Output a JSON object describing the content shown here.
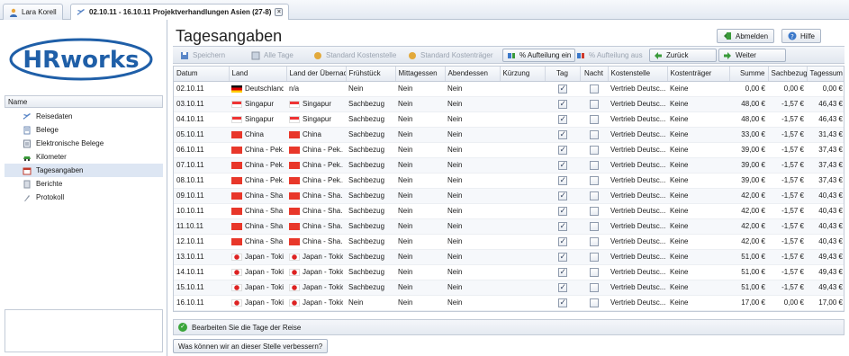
{
  "tabs": [
    {
      "label": "Lara Korell",
      "icon": "user-icon"
    },
    {
      "label": "02.10.11 - 16.10.11 Projektverhandlungen Asien (27-8)",
      "icon": "travel-icon",
      "active": true
    }
  ],
  "logo": {
    "text": "HRworks"
  },
  "sidebar": {
    "header": "Name",
    "items": [
      {
        "label": "Reisedaten",
        "icon": "plane-icon"
      },
      {
        "label": "Belege",
        "icon": "receipt-icon"
      },
      {
        "label": "Elektronische Belege",
        "icon": "document-icon"
      },
      {
        "label": "Kilometer",
        "icon": "car-icon"
      },
      {
        "label": "Tagesangaben",
        "icon": "calendar-icon",
        "selected": true
      },
      {
        "label": "Berichte",
        "icon": "report-icon"
      },
      {
        "label": "Protokoll",
        "icon": "log-icon"
      }
    ]
  },
  "page": {
    "title": "Tagesangaben"
  },
  "header_buttons": {
    "logout": "Abmelden",
    "help": "Hilfe"
  },
  "toolbar": {
    "save": "Speichern",
    "all_days": "Alle Tage",
    "std_cost_center": "Standard Kostenstelle",
    "std_cost_unit": "Standard Kostenträger",
    "split_on": "% Aufteilung ein",
    "split_off": "% Aufteilung aus",
    "back": "Zurück",
    "next": "Weiter"
  },
  "columns": [
    "Datum",
    "Land",
    "Land der Übernac",
    "Frühstück",
    "Mittagessen",
    "Abendessen",
    "Kürzung",
    "Tag",
    "Nacht",
    "Kostenstelle",
    "Kostenträger",
    "Summe",
    "Sachbezug",
    "Tagessum"
  ],
  "rows": [
    {
      "date": "02.10.11",
      "land": "Deutschland",
      "land_flag": "de",
      "over": "n/a",
      "over_flag": "",
      "fruh": "Nein",
      "mittag": "Nein",
      "abend": "Nein",
      "kurz": "",
      "tag": true,
      "nacht": false,
      "kst": "Vertrieb Deutsc...",
      "ktr": "Keine",
      "summe": "0,00 €",
      "sach": "0,00 €",
      "tsum": "0,00 €"
    },
    {
      "date": "03.10.11",
      "land": "Singapur",
      "land_flag": "sg",
      "over": "Singapur",
      "over_flag": "sg",
      "fruh": "Sachbezug",
      "mittag": "Nein",
      "abend": "Nein",
      "kurz": "",
      "tag": true,
      "nacht": false,
      "kst": "Vertrieb Deutsc...",
      "ktr": "Keine",
      "summe": "48,00 €",
      "sach": "-1,57 €",
      "tsum": "46,43 €"
    },
    {
      "date": "04.10.11",
      "land": "Singapur",
      "land_flag": "sg",
      "over": "Singapur",
      "over_flag": "sg",
      "fruh": "Sachbezug",
      "mittag": "Nein",
      "abend": "Nein",
      "kurz": "",
      "tag": true,
      "nacht": false,
      "kst": "Vertrieb Deutsc...",
      "ktr": "Keine",
      "summe": "48,00 €",
      "sach": "-1,57 €",
      "tsum": "46,43 €"
    },
    {
      "date": "05.10.11",
      "land": "China",
      "land_flag": "cn",
      "over": "China",
      "over_flag": "cn",
      "fruh": "Sachbezug",
      "mittag": "Nein",
      "abend": "Nein",
      "kurz": "",
      "tag": true,
      "nacht": false,
      "kst": "Vertrieb Deutsc...",
      "ktr": "Keine",
      "summe": "33,00 €",
      "sach": "-1,57 €",
      "tsum": "31,43 €"
    },
    {
      "date": "06.10.11",
      "land": "China - Pek...",
      "land_flag": "cn",
      "over": "China - Pek...",
      "over_flag": "cn",
      "fruh": "Sachbezug",
      "mittag": "Nein",
      "abend": "Nein",
      "kurz": "",
      "tag": true,
      "nacht": false,
      "kst": "Vertrieb Deutsc...",
      "ktr": "Keine",
      "summe": "39,00 €",
      "sach": "-1,57 €",
      "tsum": "37,43 €"
    },
    {
      "date": "07.10.11",
      "land": "China - Pek...",
      "land_flag": "cn",
      "over": "China - Pek...",
      "over_flag": "cn",
      "fruh": "Sachbezug",
      "mittag": "Nein",
      "abend": "Nein",
      "kurz": "",
      "tag": true,
      "nacht": false,
      "kst": "Vertrieb Deutsc...",
      "ktr": "Keine",
      "summe": "39,00 €",
      "sach": "-1,57 €",
      "tsum": "37,43 €"
    },
    {
      "date": "08.10.11",
      "land": "China - Pek...",
      "land_flag": "cn",
      "over": "China - Pek...",
      "over_flag": "cn",
      "fruh": "Sachbezug",
      "mittag": "Nein",
      "abend": "Nein",
      "kurz": "",
      "tag": true,
      "nacht": false,
      "kst": "Vertrieb Deutsc...",
      "ktr": "Keine",
      "summe": "39,00 €",
      "sach": "-1,57 €",
      "tsum": "37,43 €"
    },
    {
      "date": "09.10.11",
      "land": "China - Sha...",
      "land_flag": "cn",
      "over": "China - Sha...",
      "over_flag": "cn",
      "fruh": "Sachbezug",
      "mittag": "Nein",
      "abend": "Nein",
      "kurz": "",
      "tag": true,
      "nacht": false,
      "kst": "Vertrieb Deutsc...",
      "ktr": "Keine",
      "summe": "42,00 €",
      "sach": "-1,57 €",
      "tsum": "40,43 €"
    },
    {
      "date": "10.10.11",
      "land": "China - Sha...",
      "land_flag": "cn",
      "over": "China - Sha...",
      "over_flag": "cn",
      "fruh": "Sachbezug",
      "mittag": "Nein",
      "abend": "Nein",
      "kurz": "",
      "tag": true,
      "nacht": false,
      "kst": "Vertrieb Deutsc...",
      "ktr": "Keine",
      "summe": "42,00 €",
      "sach": "-1,57 €",
      "tsum": "40,43 €"
    },
    {
      "date": "11.10.11",
      "land": "China - Sha...",
      "land_flag": "cn",
      "over": "China - Sha...",
      "over_flag": "cn",
      "fruh": "Sachbezug",
      "mittag": "Nein",
      "abend": "Nein",
      "kurz": "",
      "tag": true,
      "nacht": false,
      "kst": "Vertrieb Deutsc...",
      "ktr": "Keine",
      "summe": "42,00 €",
      "sach": "-1,57 €",
      "tsum": "40,43 €"
    },
    {
      "date": "12.10.11",
      "land": "China - Sha...",
      "land_flag": "cn",
      "over": "China - Sha...",
      "over_flag": "cn",
      "fruh": "Sachbezug",
      "mittag": "Nein",
      "abend": "Nein",
      "kurz": "",
      "tag": true,
      "nacht": false,
      "kst": "Vertrieb Deutsc...",
      "ktr": "Keine",
      "summe": "42,00 €",
      "sach": "-1,57 €",
      "tsum": "40,43 €"
    },
    {
      "date": "13.10.11",
      "land": "Japan - Tokio",
      "land_flag": "jp",
      "over": "Japan - Tokio",
      "over_flag": "jp",
      "fruh": "Sachbezug",
      "mittag": "Nein",
      "abend": "Nein",
      "kurz": "",
      "tag": true,
      "nacht": false,
      "kst": "Vertrieb Deutsc...",
      "ktr": "Keine",
      "summe": "51,00 €",
      "sach": "-1,57 €",
      "tsum": "49,43 €"
    },
    {
      "date": "14.10.11",
      "land": "Japan - Tokio",
      "land_flag": "jp",
      "over": "Japan - Tokio",
      "over_flag": "jp",
      "fruh": "Sachbezug",
      "mittag": "Nein",
      "abend": "Nein",
      "kurz": "",
      "tag": true,
      "nacht": false,
      "kst": "Vertrieb Deutsc...",
      "ktr": "Keine",
      "summe": "51,00 €",
      "sach": "-1,57 €",
      "tsum": "49,43 €"
    },
    {
      "date": "15.10.11",
      "land": "Japan - Tokio",
      "land_flag": "jp",
      "over": "Japan - Tokio",
      "over_flag": "jp",
      "fruh": "Sachbezug",
      "mittag": "Nein",
      "abend": "Nein",
      "kurz": "",
      "tag": true,
      "nacht": false,
      "kst": "Vertrieb Deutsc...",
      "ktr": "Keine",
      "summe": "51,00 €",
      "sach": "-1,57 €",
      "tsum": "49,43 €"
    },
    {
      "date": "16.10.11",
      "land": "Japan - Tokio",
      "land_flag": "jp",
      "over": "Japan - Tokio",
      "over_flag": "jp",
      "fruh": "Nein",
      "mittag": "Nein",
      "abend": "Nein",
      "kurz": "",
      "tag": true,
      "nacht": false,
      "kst": "Vertrieb Deutsc...",
      "ktr": "Keine",
      "summe": "17,00 €",
      "sach": "0,00 €",
      "tsum": "17,00 €"
    }
  ],
  "status": {
    "text": "Bearbeiten Sie die Tage der Reise"
  },
  "feedback": {
    "label": "Was können wir an dieser Stelle verbessern?"
  },
  "colors": {
    "accent": "#2f6db5",
    "logo": "#1f5fa8",
    "selected_row": "#dde6f3"
  }
}
